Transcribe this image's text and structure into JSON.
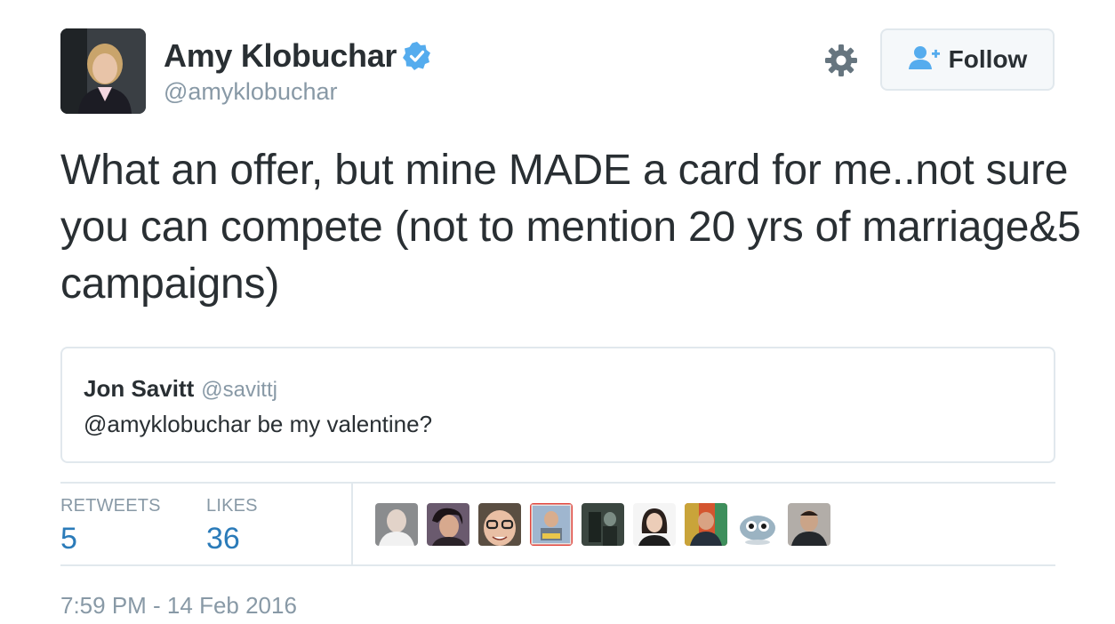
{
  "author": {
    "name": "Amy Klobuchar",
    "handle": "@amyklobuchar",
    "verified": true,
    "avatar_icon": "profile-photo"
  },
  "actions": {
    "settings_icon": "gear-icon",
    "follow_icon": "add-user-icon",
    "follow_label": "Follow"
  },
  "tweet": {
    "text": "What an offer, but mine MADE a card for me..not sure you can compete (not to mention 20 yrs of marriage&5 campaigns)"
  },
  "quoted_tweet": {
    "name": "Jon Savitt",
    "handle": "@savittj",
    "text": "@amyklobuchar be my valentine?"
  },
  "stats": {
    "retweets_label": "RETWEETS",
    "retweets_value": "5",
    "likes_label": "LIKES",
    "likes_value": "36"
  },
  "likers_count_shown": 9,
  "timestamp": "7:59 PM - 14 Feb 2016",
  "colors": {
    "text": "#292f33",
    "secondary": "#8899a6",
    "link_blue": "#2b7bb9",
    "verified_blue": "#55acee",
    "border": "#e1e8ed"
  }
}
